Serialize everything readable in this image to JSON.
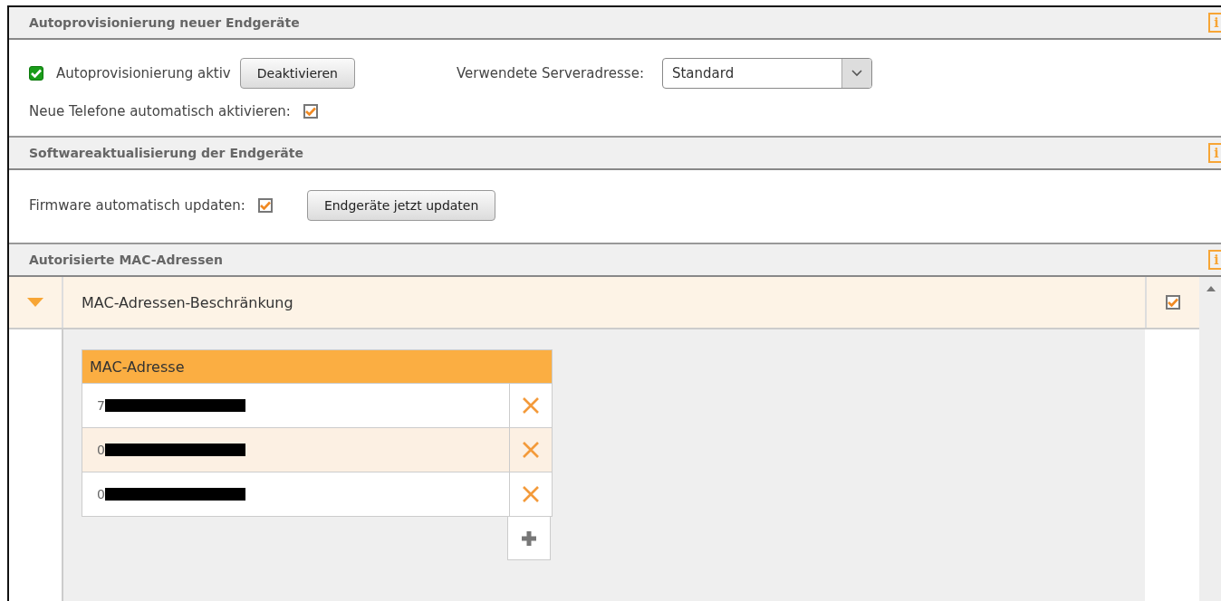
{
  "sections": [
    {
      "title": "Autoprovisionierung neuer Endgeräte",
      "info": "i"
    },
    {
      "title": "Softwareaktualisierung der Endgeräte",
      "info": "i"
    },
    {
      "title": "Autorisierte MAC-Adressen",
      "info": "i"
    }
  ],
  "autoprov": {
    "status_checked": true,
    "status_label": "Autoprovisionierung aktiv",
    "toggle_button": "Deaktivieren",
    "server_label": "Verwendete Serveradresse:",
    "server_value": "Standard",
    "auto_activate_label": "Neue Telefone automatisch aktivieren:",
    "auto_activate_checked": true
  },
  "firmware": {
    "label": "Firmware automatisch updaten:",
    "checked": true,
    "button": "Endgeräte jetzt updaten"
  },
  "mac": {
    "restriction_label": "MAC-Adressen-Beschränkung",
    "expanded": true,
    "restriction_checked": true,
    "column": "MAC-Adresse",
    "rows": [
      {
        "prefix": "7",
        "selected": false
      },
      {
        "prefix": "0",
        "selected": true
      },
      {
        "prefix": "0",
        "selected": false
      }
    ]
  }
}
